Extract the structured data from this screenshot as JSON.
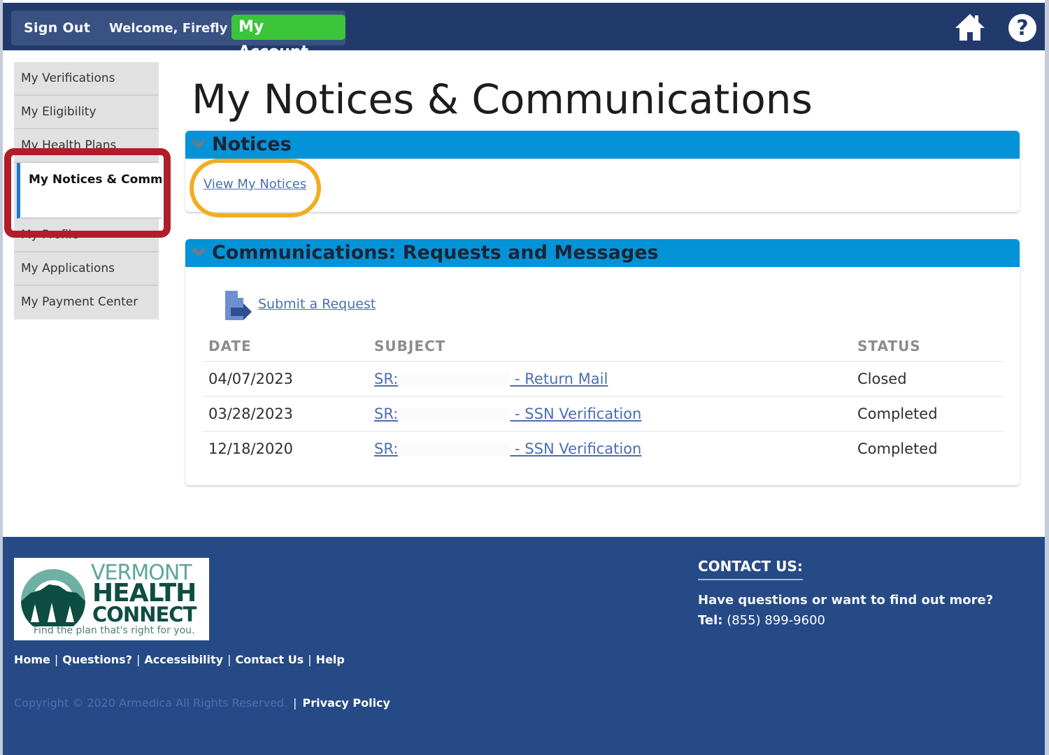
{
  "topbar": {
    "sign_out": "Sign Out",
    "welcome": "Welcome, Firefly",
    "my_account": "My Account",
    "icons": [
      "home-icon",
      "help-icon"
    ]
  },
  "sidebar": {
    "items": [
      {
        "label": "My Verifications",
        "active": false
      },
      {
        "label": "My Eligibility",
        "active": false
      },
      {
        "label": "My Health Plans",
        "active": false
      },
      {
        "label": "My Notices & Communications",
        "active": true
      },
      {
        "label": "My Profile",
        "active": false
      },
      {
        "label": "My Applications",
        "active": false
      },
      {
        "label": "My Payment Center",
        "active": false
      }
    ]
  },
  "main": {
    "title": "My Notices & Communications",
    "notices": {
      "header": "Notices",
      "link": "View My Notices"
    },
    "communications": {
      "header": "Communications: Requests and Messages",
      "submit_link": "Submit a Request",
      "columns": [
        "DATE",
        "SUBJECT",
        "STATUS"
      ],
      "rows": [
        {
          "date": "04/07/2023",
          "subject_prefix": "SR:",
          "subject_suffix": " - Return Mail",
          "status": "Closed"
        },
        {
          "date": "03/28/2023",
          "subject_prefix": "SR:",
          "subject_suffix": " - SSN Verification",
          "status": "Completed"
        },
        {
          "date": "12/18/2020",
          "subject_prefix": "SR:",
          "subject_suffix": " - SSN Verification",
          "status": "Completed"
        }
      ]
    }
  },
  "footer": {
    "logo": {
      "line1": "VERMONT",
      "line2": "HEALTH",
      "line3": "CONNECT",
      "tagline": "Find the plan that's right for you."
    },
    "links": [
      "Home",
      "Questions?",
      "Accessibility",
      "Contact Us",
      "Help"
    ],
    "copyright": "Copyright © 2020 Armedica All Rights Reserved.",
    "privacy": "Privacy Policy",
    "contact": {
      "title": "CONTACT US:",
      "question": "Have questions or want to find out more?",
      "tel_label": "Tel:",
      "tel_number": "(855) 899-9600"
    }
  },
  "colors": {
    "topbar": "#223a6b",
    "my_account_green": "#3ac53a",
    "panel_header": "#0593d7",
    "footer": "#264a86",
    "highlight_red": "#b01e2a",
    "highlight_gold": "#f2ad1f",
    "link": "#4a6fb0"
  }
}
